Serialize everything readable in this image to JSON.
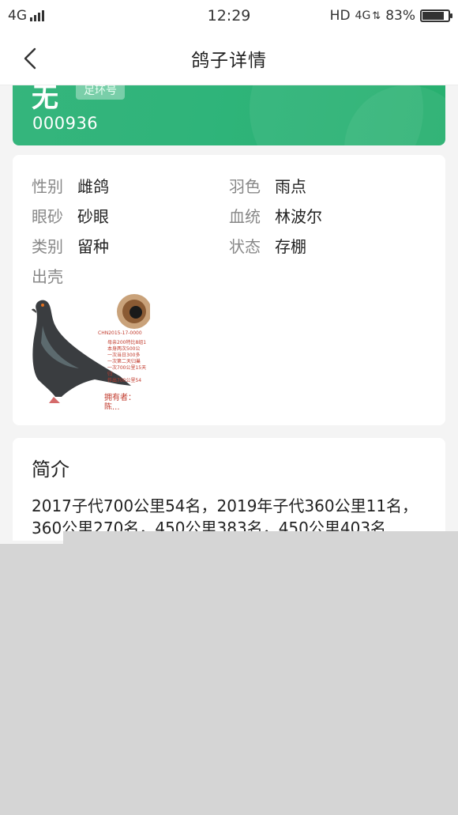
{
  "status_bar": {
    "network": "4G",
    "time": "12:29",
    "hd": "HD",
    "network_right": "4G",
    "battery_percent_text": "83%",
    "battery_level": 0.83
  },
  "header": {
    "title": "鸽子详情"
  },
  "pigeon": {
    "name": "无",
    "tag": "足环号",
    "ring_number": "000936"
  },
  "details": [
    {
      "label": "性别",
      "value": "雌鸽"
    },
    {
      "label": "羽色",
      "value": "雨点"
    },
    {
      "label": "眼砂",
      "value": "砂眼"
    },
    {
      "label": "血统",
      "value": "林波尔"
    },
    {
      "label": "类别",
      "value": "留种"
    },
    {
      "label": "状态",
      "value": "存棚"
    },
    {
      "label": "出壳",
      "value": ""
    }
  ],
  "photo": {
    "caption_ring": "CHN2015-17-0000",
    "caption_lines": [
      "母亲200特比8组1",
      "本身两次500公",
      "一次当日300多",
      "一次第二天归巢",
      "一次700公里15天归",
      "",
      "作出700公里54"
    ],
    "owner": "拥有者：陈..."
  },
  "intro": {
    "title": "简介",
    "text": "2017子代700公里54名，2019年子代360公里11名，360公里270名，450公里383名，450公里403名"
  },
  "colors": {
    "accent_green": "#2fb47a",
    "background": "#f4f4f4",
    "overlay": "#d5d5d5"
  }
}
